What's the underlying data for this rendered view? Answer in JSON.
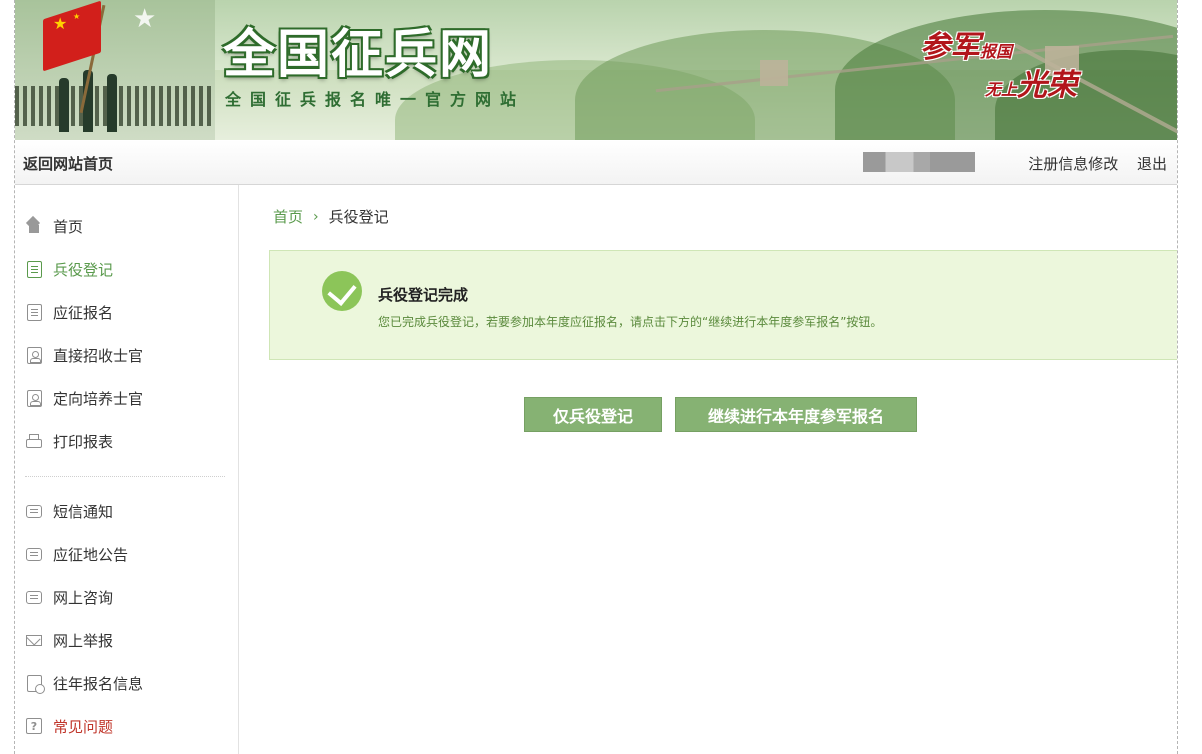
{
  "banner": {
    "title": "全国征兵网",
    "subtitle": "全国征兵报名唯一官方网站",
    "slogan_line1_big": "参军",
    "slogan_line1_small": "报国",
    "slogan_line2_small": "无上",
    "slogan_line2_big": "光荣"
  },
  "topbar": {
    "home_link": "返回网站首页",
    "edit_info": "注册信息修改",
    "logout": "退出"
  },
  "sidebar": {
    "items": [
      {
        "label": "首页",
        "icon": "home-icon"
      },
      {
        "label": "兵役登记",
        "icon": "document-icon",
        "active": true
      },
      {
        "label": "应征报名",
        "icon": "document-icon"
      },
      {
        "label": "直接招收士官",
        "icon": "person-card-icon"
      },
      {
        "label": "定向培养士官",
        "icon": "person-card-icon"
      },
      {
        "label": "打印报表",
        "icon": "printer-icon"
      },
      {
        "label": "短信通知",
        "icon": "message-icon"
      },
      {
        "label": "应征地公告",
        "icon": "message-icon"
      },
      {
        "label": "网上咨询",
        "icon": "message-icon"
      },
      {
        "label": "网上举报",
        "icon": "mail-icon"
      },
      {
        "label": "往年报名信息",
        "icon": "history-icon"
      },
      {
        "label": "常见问题",
        "icon": "question-icon"
      }
    ]
  },
  "breadcrumb": {
    "home": "首页",
    "separator": "›",
    "current": "兵役登记"
  },
  "notice": {
    "title": "兵役登记完成",
    "text": "您已完成兵役登记，若要参加本年度应征报名，请点击下方的“继续进行本年度参军报名”按钮。"
  },
  "buttons": {
    "register_only": "仅兵役登记",
    "continue_enlist": "继续进行本年度参军报名"
  },
  "colors": {
    "accent_green": "#86b273",
    "notice_bg": "#ecf7dc",
    "check_green": "#8cc559",
    "faq_red": "#c0352a"
  }
}
